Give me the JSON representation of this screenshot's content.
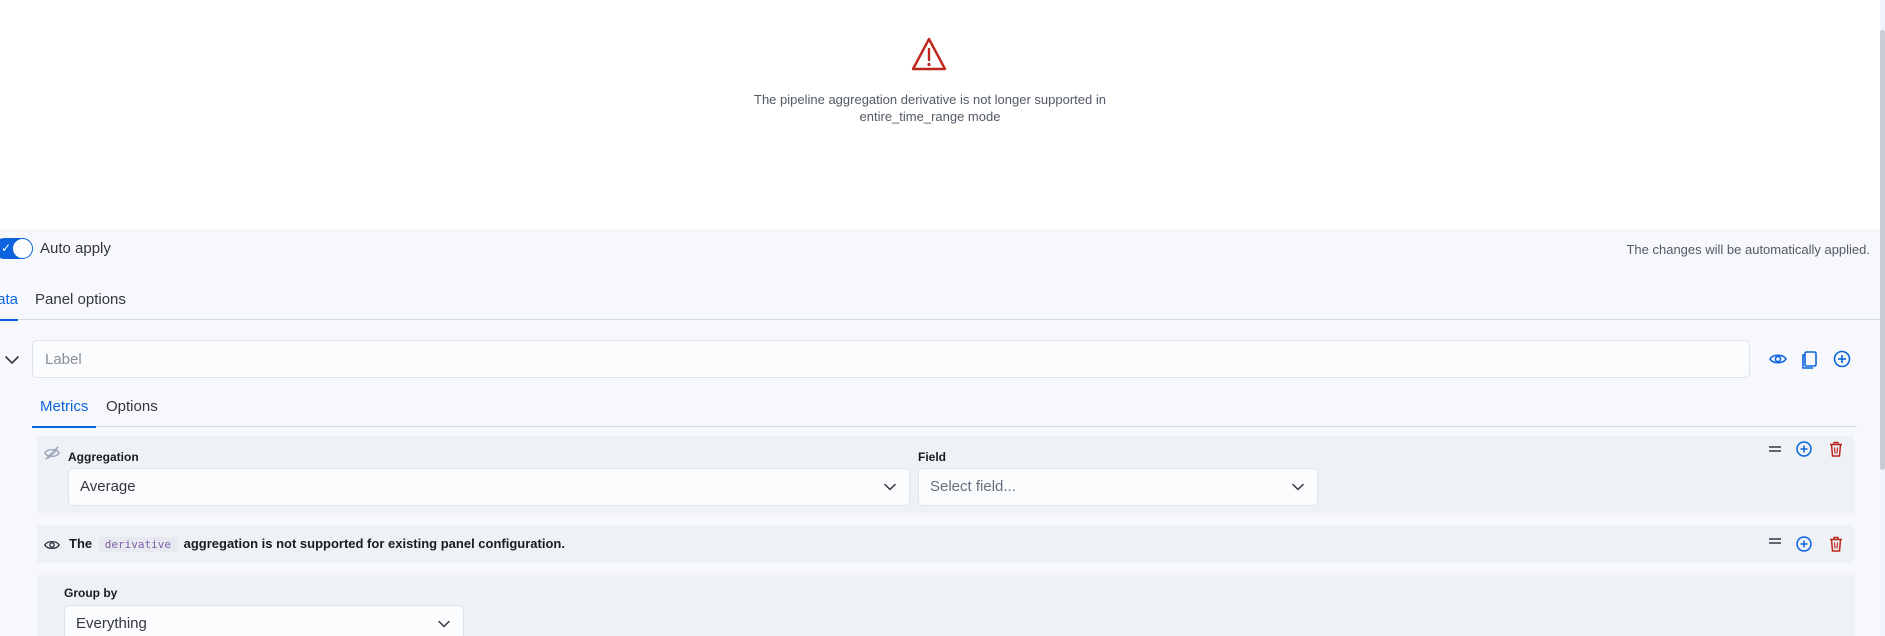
{
  "preview": {
    "error_icon": "warning-triangle-icon",
    "error_message": "The pipeline aggregation derivative is not longer supported in entire_time_range mode"
  },
  "auto_apply": {
    "label": "Auto apply",
    "enabled": true,
    "note": "The changes will be automatically applied."
  },
  "main_tabs": [
    {
      "label": "Data",
      "active": true
    },
    {
      "label": "Panel options",
      "active": false
    }
  ],
  "series": {
    "label_placeholder": "Label",
    "label_value": "",
    "actions": [
      "eye-icon",
      "copy-icon",
      "add-icon"
    ]
  },
  "sub_tabs": [
    {
      "label": "Metrics",
      "active": true
    },
    {
      "label": "Options",
      "active": false
    }
  ],
  "metrics": [
    {
      "aggregation_label": "Aggregation",
      "aggregation_value": "Average",
      "field_label": "Field",
      "field_placeholder": "Select field..."
    },
    {
      "message_prefix": "The",
      "message_code": "derivative",
      "message_suffix": "aggregation is not supported for existing panel configuration."
    }
  ],
  "group_by": {
    "label": "Group by",
    "value": "Everything"
  },
  "colors": {
    "accent": "#0b64dd",
    "danger": "#bd271e",
    "panel_bg": "#f7f8fc",
    "row_bg": "#eef1f6"
  }
}
